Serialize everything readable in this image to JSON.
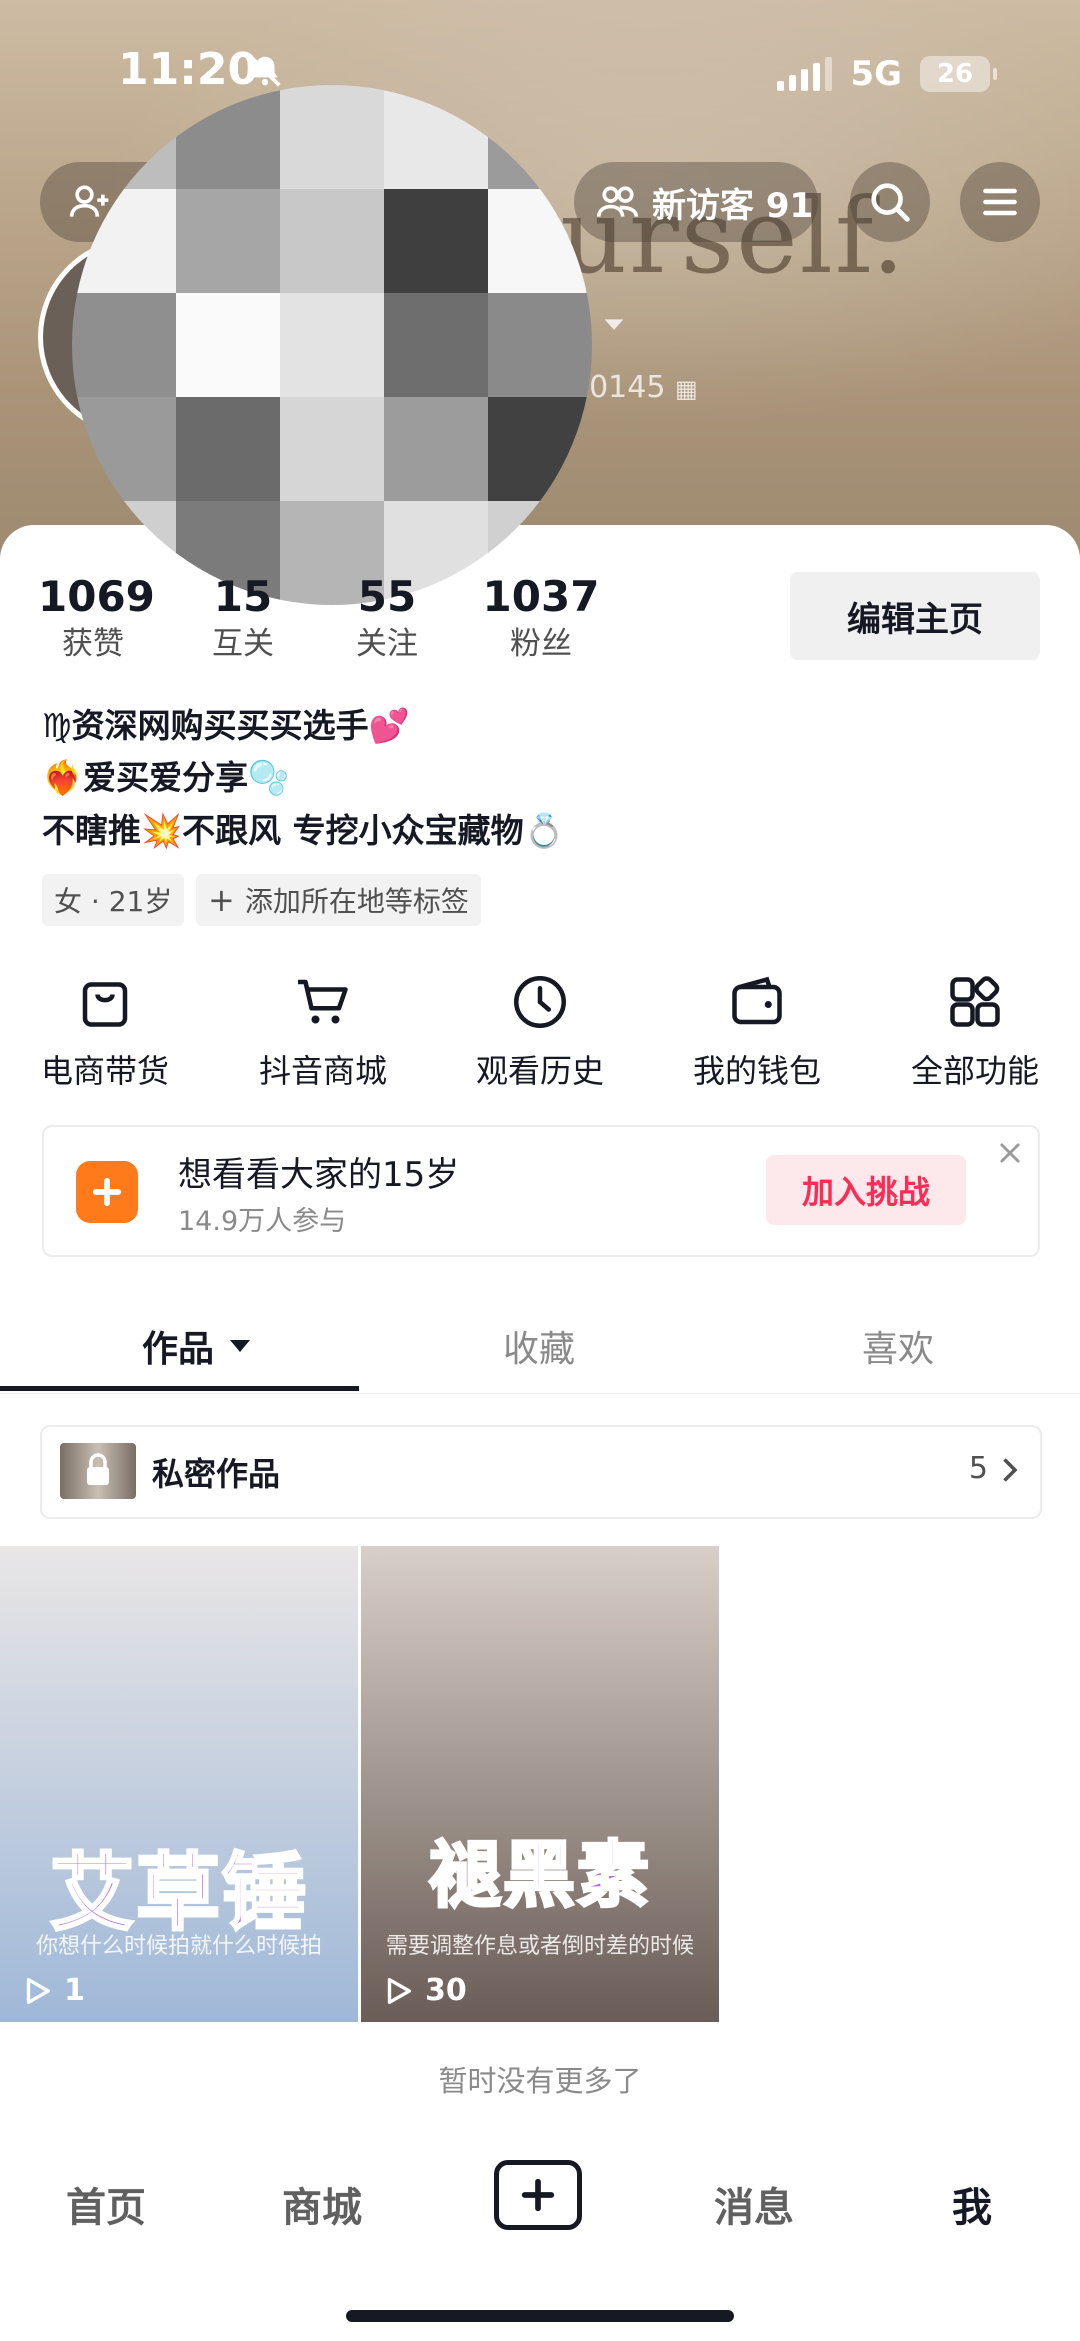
{
  "status": {
    "time": "11:20",
    "network": "5G",
    "battery": "26"
  },
  "header": {
    "visitors_label": "新访客 91",
    "background_text": "urself.",
    "id_suffix": "60145"
  },
  "stats": [
    {
      "value": "1069",
      "label": "获赞"
    },
    {
      "value": "15",
      "label": "互关"
    },
    {
      "value": "55",
      "label": "关注"
    },
    {
      "value": "1037",
      "label": "粉丝"
    }
  ],
  "edit_profile": "编辑主页",
  "bio": {
    "line1": "♍资深网购买买买选手💕",
    "line2": "❤️‍🔥爱买爱分享🫧",
    "line3": "不瞎推💥不跟风 专挖小众宝藏物💍"
  },
  "tags": {
    "gender_age": "女 · 21岁",
    "add_location": "添加所在地等标签"
  },
  "functions": [
    {
      "label": "电商带货",
      "icon": "shopping-bag-icon"
    },
    {
      "label": "抖音商城",
      "icon": "cart-icon"
    },
    {
      "label": "观看历史",
      "icon": "clock-icon"
    },
    {
      "label": "我的钱包",
      "icon": "wallet-icon"
    },
    {
      "label": "全部功能",
      "icon": "grid-icon"
    }
  ],
  "challenge": {
    "title": "想看看大家的15岁",
    "subtitle": "14.9万人参与",
    "button": "加入挑战"
  },
  "tabs": [
    "作品",
    "收藏",
    "喜欢"
  ],
  "private_works": {
    "label": "私密作品",
    "count": "5"
  },
  "videos": [
    {
      "title": "艾草锤",
      "plays": "1",
      "caption": "你想什么时候拍就什么时候拍",
      "bg": [
        "#e9e6e6",
        "#9fb8d8"
      ]
    },
    {
      "title": "褪黑素",
      "plays": "30",
      "caption": "需要调整作息或者倒时差的时候",
      "bg": [
        "#d8cfc8",
        "#6a5c56"
      ]
    }
  ],
  "no_more": "暂时没有更多了",
  "bottom_nav": [
    "首页",
    "商城",
    "消息",
    "我"
  ],
  "colors": {
    "accent": "#fe2c55",
    "challenge_icon": "#ff7a1a",
    "video_title": "#b06adb"
  }
}
